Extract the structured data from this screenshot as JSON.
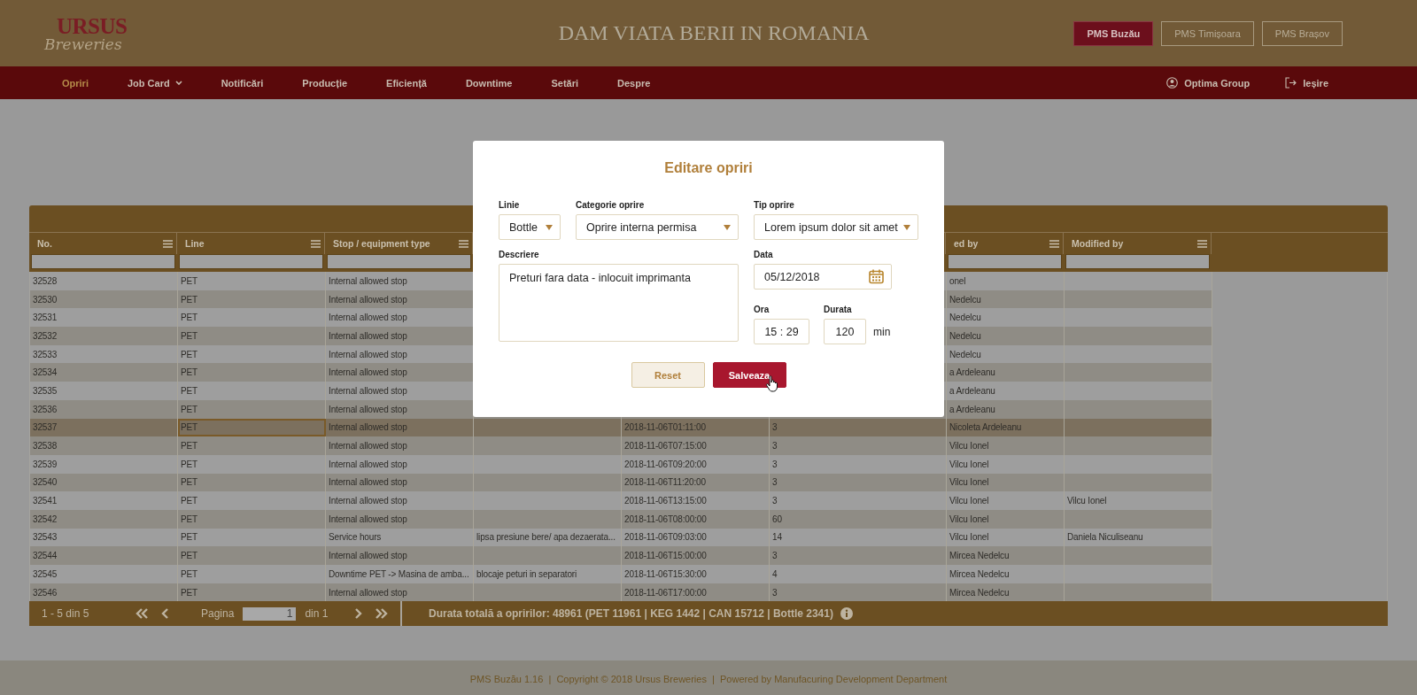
{
  "header": {
    "logo": {
      "brand": "URSUS",
      "sub": "Breweries"
    },
    "slogan": "DAM VIATA BERII IN ROMANIA",
    "plants": [
      {
        "label": "PMS Buzău",
        "selected": true
      },
      {
        "label": "PMS Timișoara",
        "selected": false
      },
      {
        "label": "PMS Brașov",
        "selected": false
      }
    ]
  },
  "nav": {
    "items": [
      {
        "label": "Opriri",
        "selected": true,
        "dropdown": false
      },
      {
        "label": "Job Card",
        "selected": false,
        "dropdown": true
      },
      {
        "label": "Notificări",
        "selected": false,
        "dropdown": false
      },
      {
        "label": "Producție",
        "selected": false,
        "dropdown": false
      },
      {
        "label": "Eficiență",
        "selected": false,
        "dropdown": false
      },
      {
        "label": "Downtime",
        "selected": false,
        "dropdown": false
      },
      {
        "label": "Setări",
        "selected": false,
        "dropdown": false
      },
      {
        "label": "Despre",
        "selected": false,
        "dropdown": false
      }
    ],
    "user": "Optima Group",
    "logout": "Ieșire"
  },
  "table": {
    "columns": [
      {
        "label": "No."
      },
      {
        "label": "Line"
      },
      {
        "label": "Stop / equipment type"
      },
      {},
      {},
      {},
      {
        "label": "ed by"
      },
      {
        "label": "Modified by"
      }
    ],
    "rows": [
      {
        "selected": false,
        "cells": [
          "32528",
          "PET",
          "Internal allowed stop",
          null,
          null,
          null,
          "onel",
          null
        ]
      },
      {
        "selected": false,
        "cells": [
          "32530",
          "PET",
          "Internal allowed stop",
          null,
          null,
          null,
          "Nedelcu",
          null
        ]
      },
      {
        "selected": false,
        "cells": [
          "32531",
          "PET",
          "Internal allowed stop",
          null,
          null,
          null,
          "Nedelcu",
          null
        ]
      },
      {
        "selected": false,
        "cells": [
          "32532",
          "PET",
          "Internal allowed stop",
          null,
          null,
          null,
          "Nedelcu",
          null
        ]
      },
      {
        "selected": false,
        "cells": [
          "32533",
          "PET",
          "Internal allowed stop",
          null,
          null,
          null,
          "Nedelcu",
          null
        ]
      },
      {
        "selected": false,
        "cells": [
          "32534",
          "PET",
          "Internal allowed stop",
          null,
          null,
          null,
          "a Ardeleanu",
          null
        ]
      },
      {
        "selected": false,
        "cells": [
          "32535",
          "PET",
          "Internal allowed stop",
          null,
          null,
          null,
          "a Ardeleanu",
          null
        ]
      },
      {
        "selected": false,
        "cells": [
          "32536",
          "PET",
          "Internal allowed stop",
          null,
          null,
          null,
          "a Ardeleanu",
          null
        ]
      },
      {
        "selected": true,
        "cells": [
          "32537",
          "PET",
          "Internal allowed stop",
          null,
          "2018-11-06T01:11:00",
          "3",
          "Nicoleta Ardeleanu",
          null
        ]
      },
      {
        "selected": false,
        "cells": [
          "32538",
          "PET",
          "Internal allowed stop",
          null,
          "2018-11-06T07:15:00",
          "3",
          "Vilcu Ionel",
          null
        ]
      },
      {
        "selected": false,
        "cells": [
          "32539",
          "PET",
          "Internal allowed stop",
          null,
          "2018-11-06T09:20:00",
          "3",
          "Vilcu Ionel",
          null
        ]
      },
      {
        "selected": false,
        "cells": [
          "32540",
          "PET",
          "Internal allowed stop",
          null,
          "2018-11-06T11:20:00",
          "3",
          "Vilcu Ionel",
          null
        ]
      },
      {
        "selected": false,
        "cells": [
          "32541",
          "PET",
          "Internal allowed stop",
          null,
          "2018-11-06T13:15:00",
          "3",
          "Vilcu Ionel",
          "Vilcu Ionel"
        ]
      },
      {
        "selected": false,
        "cells": [
          "32542",
          "PET",
          "Internal allowed stop",
          null,
          "2018-11-06T08:00:00",
          "60",
          "Vilcu Ionel",
          null
        ]
      },
      {
        "selected": false,
        "cells": [
          "32543",
          "PET",
          "Service hours",
          "lipsa presiune bere/ apa dezaerata...",
          "2018-11-06T09:03:00",
          "14",
          "Vilcu Ionel",
          "Daniela Niculiseanu"
        ]
      },
      {
        "selected": false,
        "cells": [
          "32544",
          "PET",
          "Internal allowed stop",
          null,
          "2018-11-06T15:00:00",
          "3",
          "Mircea Nedelcu",
          null
        ]
      },
      {
        "selected": false,
        "cells": [
          "32545",
          "PET",
          "Downtime PET -> Masina de amba...",
          "blocaje peturi in separatori",
          "2018-11-06T15:30:00",
          "4",
          "Mircea Nedelcu",
          null
        ]
      },
      {
        "selected": false,
        "cells": [
          "32546",
          "PET",
          "Internal allowed stop",
          null,
          "2018-11-06T17:00:00",
          "3",
          "Mircea Nedelcu",
          null
        ]
      }
    ],
    "pager": {
      "range": "1 - 5 din 5",
      "page_label": "Pagina",
      "page": "1",
      "of": "din 1",
      "total": "Durata totală a opririlor: 48961 (PET 11961 | KEG 1442 | CAN 15712 | Bottle 2341)"
    }
  },
  "modal": {
    "title": "Editare opriri",
    "fields": [
      {
        "kind": "select",
        "label": "Linie",
        "value": "Bottle"
      },
      {
        "kind": "select",
        "label": "Categorie oprire",
        "value": "Oprire interna permisa"
      },
      {
        "kind": "select",
        "label": "Tip oprire",
        "value": "Lorem ipsum dolor sit amet"
      },
      {
        "kind": "textarea",
        "label": "Descriere",
        "value": "Preturi fara data - inlocuit imprimanta"
      },
      {
        "kind": "date",
        "label": "Data",
        "value": "05/12/2018"
      },
      {
        "kind": "time",
        "label": "Ora",
        "value": "15 : 29"
      },
      {
        "kind": "number",
        "label": "Durata",
        "value": "120",
        "unit": "min"
      }
    ],
    "buttons": [
      {
        "label": "Reset",
        "kind": "secondary"
      },
      {
        "label": "Salveaza",
        "kind": "primary"
      }
    ]
  },
  "footer": {
    "text": "PMS Buzău 1.16  |  Copyright © 2018 Ursus Breweries  |  Powered by Manufacuring Development Department"
  }
}
